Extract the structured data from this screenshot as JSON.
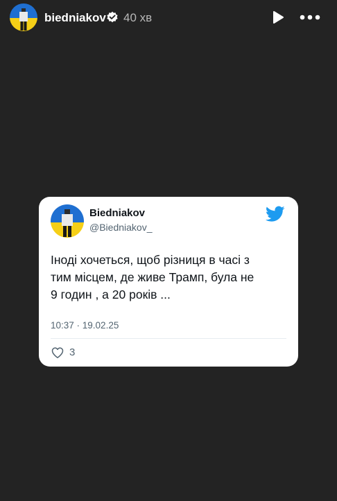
{
  "story": {
    "username": "biedniakov",
    "time_ago": "40 хв",
    "icons": {
      "verified": "verified-badge-icon",
      "play": "play-icon",
      "more": "more-options-icon"
    }
  },
  "tweet": {
    "display_name": "Biedniakov",
    "handle": "@Biedniakov_",
    "text": "Іноді хочеться, щоб різниця в часі з\nтим місцем, де живе Трамп, була не\n9 годин , а 20 років ...",
    "timestamp": "10:37 · 19.02.25",
    "likes": "3",
    "icons": {
      "brand": "twitter-bird-icon",
      "like": "heart-icon"
    }
  },
  "colors": {
    "background": "#232323",
    "card": "#ffffff",
    "twitter_blue": "#1d9bf0",
    "flag_blue": "#1f6fd1",
    "flag_yellow": "#f5cf17"
  }
}
